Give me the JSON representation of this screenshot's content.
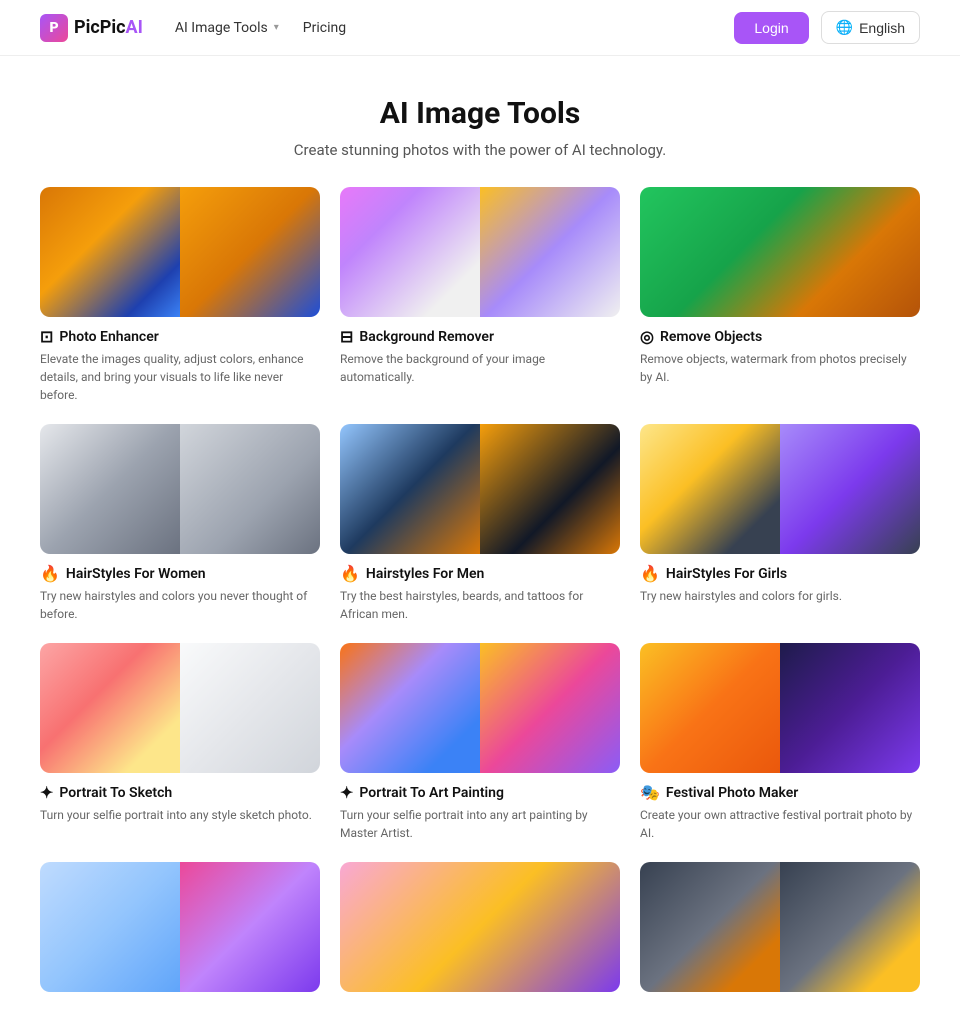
{
  "nav": {
    "logo_letter": "P",
    "logo_name_part1": "PicPic",
    "logo_name_part2": "AI",
    "menu": [
      {
        "label": "AI Image Tools",
        "has_dropdown": true
      },
      {
        "label": "Pricing",
        "has_dropdown": false
      }
    ],
    "login_label": "Login",
    "lang_label": "English"
  },
  "hero": {
    "title": "AI Image Tools",
    "subtitle": "Create stunning photos with the power of AI technology."
  },
  "cards": [
    {
      "id": "photo-enhancer",
      "icon": "⊡",
      "title": "Photo Enhancer",
      "desc": "Elevate the images quality, adjust colors, enhance details, and bring your visuals to life like never before.",
      "img_type": "double",
      "img1_class": "img-fox1",
      "img2_class": "img-fox2"
    },
    {
      "id": "background-remover",
      "icon": "⊟",
      "title": "Background Remover",
      "desc": "Remove the background of your image automatically.",
      "img_type": "double",
      "img1_class": "img-girl1",
      "img2_class": "img-girl2"
    },
    {
      "id": "remove-objects",
      "icon": "◎",
      "title": "Remove Objects",
      "desc": "Remove objects, watermark from photos precisely by AI.",
      "img_type": "single",
      "img1_class": "img-dog1"
    },
    {
      "id": "hairstyles-women",
      "icon": "🔥",
      "title": "HairStyles For Women",
      "desc": "Try new hairstyles and colors you never thought of before.",
      "img_type": "double",
      "img1_class": "img-woman1",
      "img2_class": "img-woman2"
    },
    {
      "id": "hairstyles-men",
      "icon": "🔥",
      "title": "Hairstyles For Men",
      "desc": "Try the best hairstyles, beards, and tattoos for African men.",
      "img_type": "double",
      "img1_class": "img-man1",
      "img2_class": "img-man2"
    },
    {
      "id": "hairstyles-girls",
      "icon": "🔥",
      "title": "HairStyles For Girls",
      "desc": "Try new hairstyles and colors for girls.",
      "img_type": "double",
      "img1_class": "img-child1",
      "img2_class": "img-child2"
    },
    {
      "id": "portrait-sketch",
      "icon": "✦",
      "title": "Portrait To Sketch",
      "desc": "Turn your selfie portrait into any style sketch photo.",
      "img_type": "double",
      "img1_class": "img-portrait1",
      "img2_class": "img-sketch"
    },
    {
      "id": "portrait-art",
      "icon": "✦",
      "title": "Portrait To Art Painting",
      "desc": "Turn your selfie portrait into any art painting by Master Artist.",
      "img_type": "double",
      "img1_class": "img-painting1",
      "img2_class": "img-painting2"
    },
    {
      "id": "festival-maker",
      "icon": "🎭",
      "title": "Festival Photo Maker",
      "desc": "Create your own attractive festival portrait photo by AI.",
      "img_type": "double",
      "img1_class": "img-festival1",
      "img2_class": "img-festival2"
    },
    {
      "id": "bottom1",
      "icon": "",
      "title": "",
      "desc": "",
      "img_type": "double",
      "img1_class": "img-bottom1a",
      "img2_class": "img-bottom1b"
    },
    {
      "id": "bottom2",
      "icon": "",
      "title": "",
      "desc": "",
      "img_type": "single",
      "img1_class": "img-bottom2"
    },
    {
      "id": "bottom3",
      "icon": "",
      "title": "",
      "desc": "",
      "img_type": "double",
      "img1_class": "img-bottom3a",
      "img2_class": "img-bottom3b"
    }
  ]
}
